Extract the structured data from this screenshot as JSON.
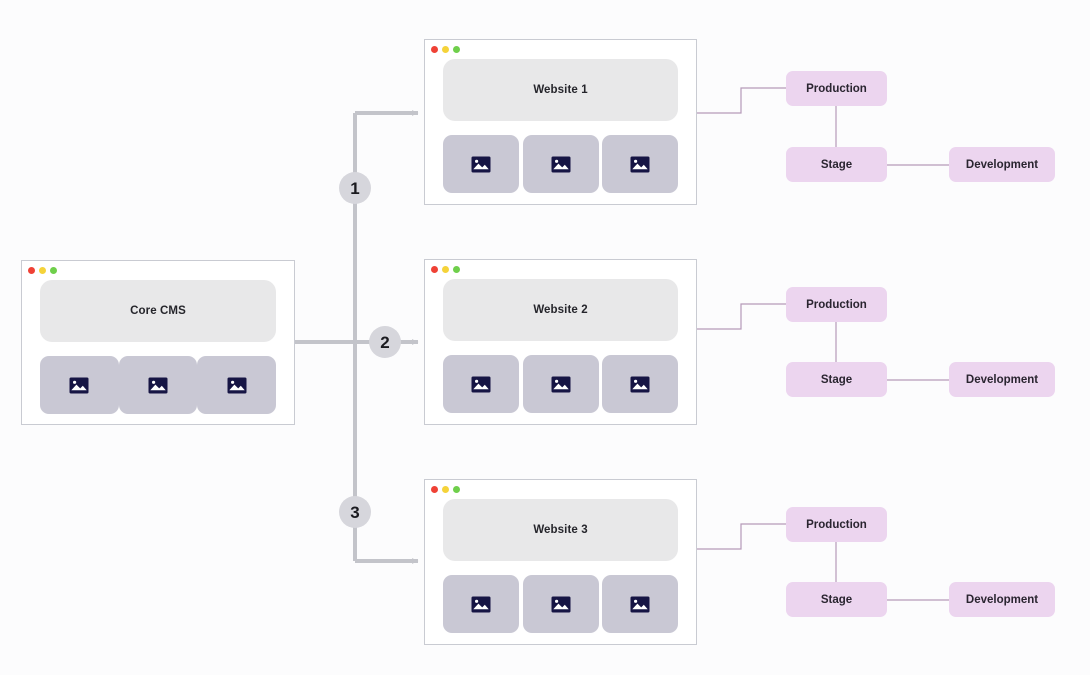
{
  "canvas": {
    "background": "#fcfcfd",
    "title": "CMS multi-site environment architecture diagram"
  },
  "colors": {
    "window_bg": "#ffffff",
    "window_border": "#c9cbd2",
    "hero_bg": "#e8e8e9",
    "thumb_bg": "#c9c8d4",
    "thumb_icon": "#161544",
    "env_bg": "#ecd5ef",
    "env_text": "#2a2530",
    "badge_bg": "#d6d6dc",
    "badge_text": "#1a1a1f",
    "gray_edge": "#c3c4ca",
    "pink_edge": "#b59ab8",
    "traffic_red": "#ef4136",
    "traffic_yellow": "#f5d33a",
    "traffic_green": "#6fcf4b"
  },
  "source": {
    "title": "Core CMS",
    "traffic_lights": [
      "red",
      "yellow",
      "green"
    ],
    "thumbnails": [
      "image-placeholder",
      "image-placeholder",
      "image-placeholder"
    ]
  },
  "branches": [
    {
      "badge": "1",
      "site": {
        "title": "Website 1",
        "traffic_lights": [
          "red",
          "yellow",
          "green"
        ],
        "thumbnails": [
          "image-placeholder",
          "image-placeholder",
          "image-placeholder"
        ]
      },
      "environments": {
        "production": "Production",
        "stage": "Stage",
        "development": "Development"
      }
    },
    {
      "badge": "2",
      "site": {
        "title": "Website 2",
        "traffic_lights": [
          "red",
          "yellow",
          "green"
        ],
        "thumbnails": [
          "image-placeholder",
          "image-placeholder",
          "image-placeholder"
        ]
      },
      "environments": {
        "production": "Production",
        "stage": "Stage",
        "development": "Development"
      }
    },
    {
      "badge": "3",
      "site": {
        "title": "Website 3",
        "traffic_lights": [
          "red",
          "yellow",
          "green"
        ],
        "thumbnails": [
          "image-placeholder",
          "image-placeholder",
          "image-placeholder"
        ]
      },
      "environments": {
        "production": "Production",
        "stage": "Stage",
        "development": "Development"
      }
    }
  ]
}
